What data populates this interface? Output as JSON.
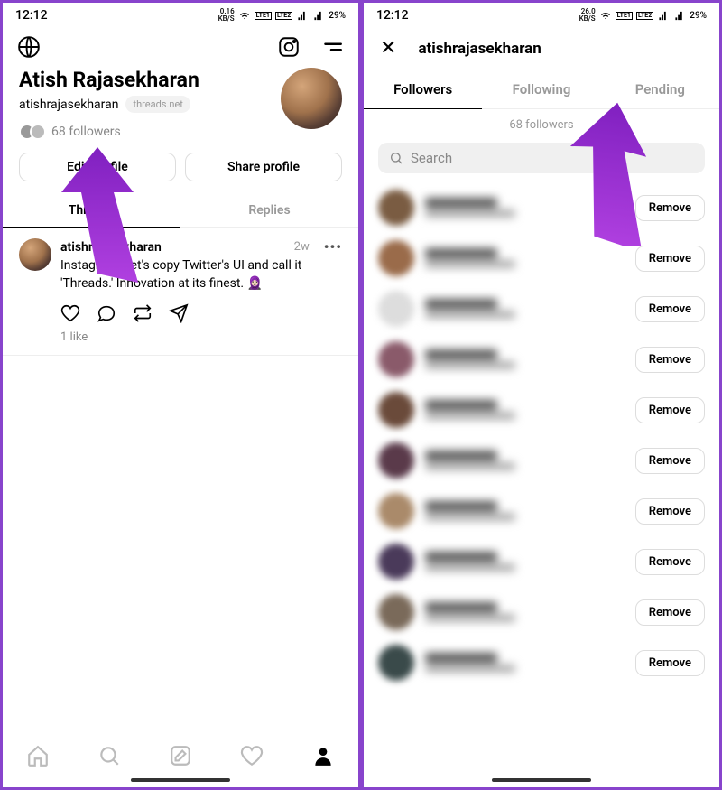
{
  "status": {
    "time": "12:12",
    "kbs_left": "0.16",
    "kbs_right": "26.0",
    "kbs_unit": "KB/S",
    "battery": "29%"
  },
  "profile": {
    "display_name": "Atish Rajasekharan",
    "username": "atishrajasekharan",
    "badge": "threads.net",
    "followers_label": "68 followers",
    "edit_btn": "Edit profile",
    "share_btn": "Share profile"
  },
  "tabs": {
    "threads": "Threads",
    "replies": "Replies"
  },
  "post": {
    "username": "atishrajasekharan",
    "time": "2w",
    "text": "Instagram: Let's copy Twitter's UI and call it 'Threads.' Innovation at its finest. 🧕🏻",
    "likes": "1 like"
  },
  "followers_screen": {
    "header_username": "atishrajasekharan",
    "tabs": {
      "followers": "Followers",
      "following": "Following",
      "pending": "Pending"
    },
    "count_label": "68 followers",
    "search_placeholder": "Search",
    "remove_label": "Remove",
    "rows": [
      {
        "c": "#7a5c42"
      },
      {
        "c": "#9a6b4a"
      },
      {
        "c": "#ddd"
      },
      {
        "c": "#8a5a6a"
      },
      {
        "c": "#6a4a3a"
      },
      {
        "c": "#5a3a4a"
      },
      {
        "c": "#aa8a6a"
      },
      {
        "c": "#4a3a5a"
      },
      {
        "c": "#7a6a5a"
      },
      {
        "c": "#3a4a4a"
      }
    ]
  }
}
